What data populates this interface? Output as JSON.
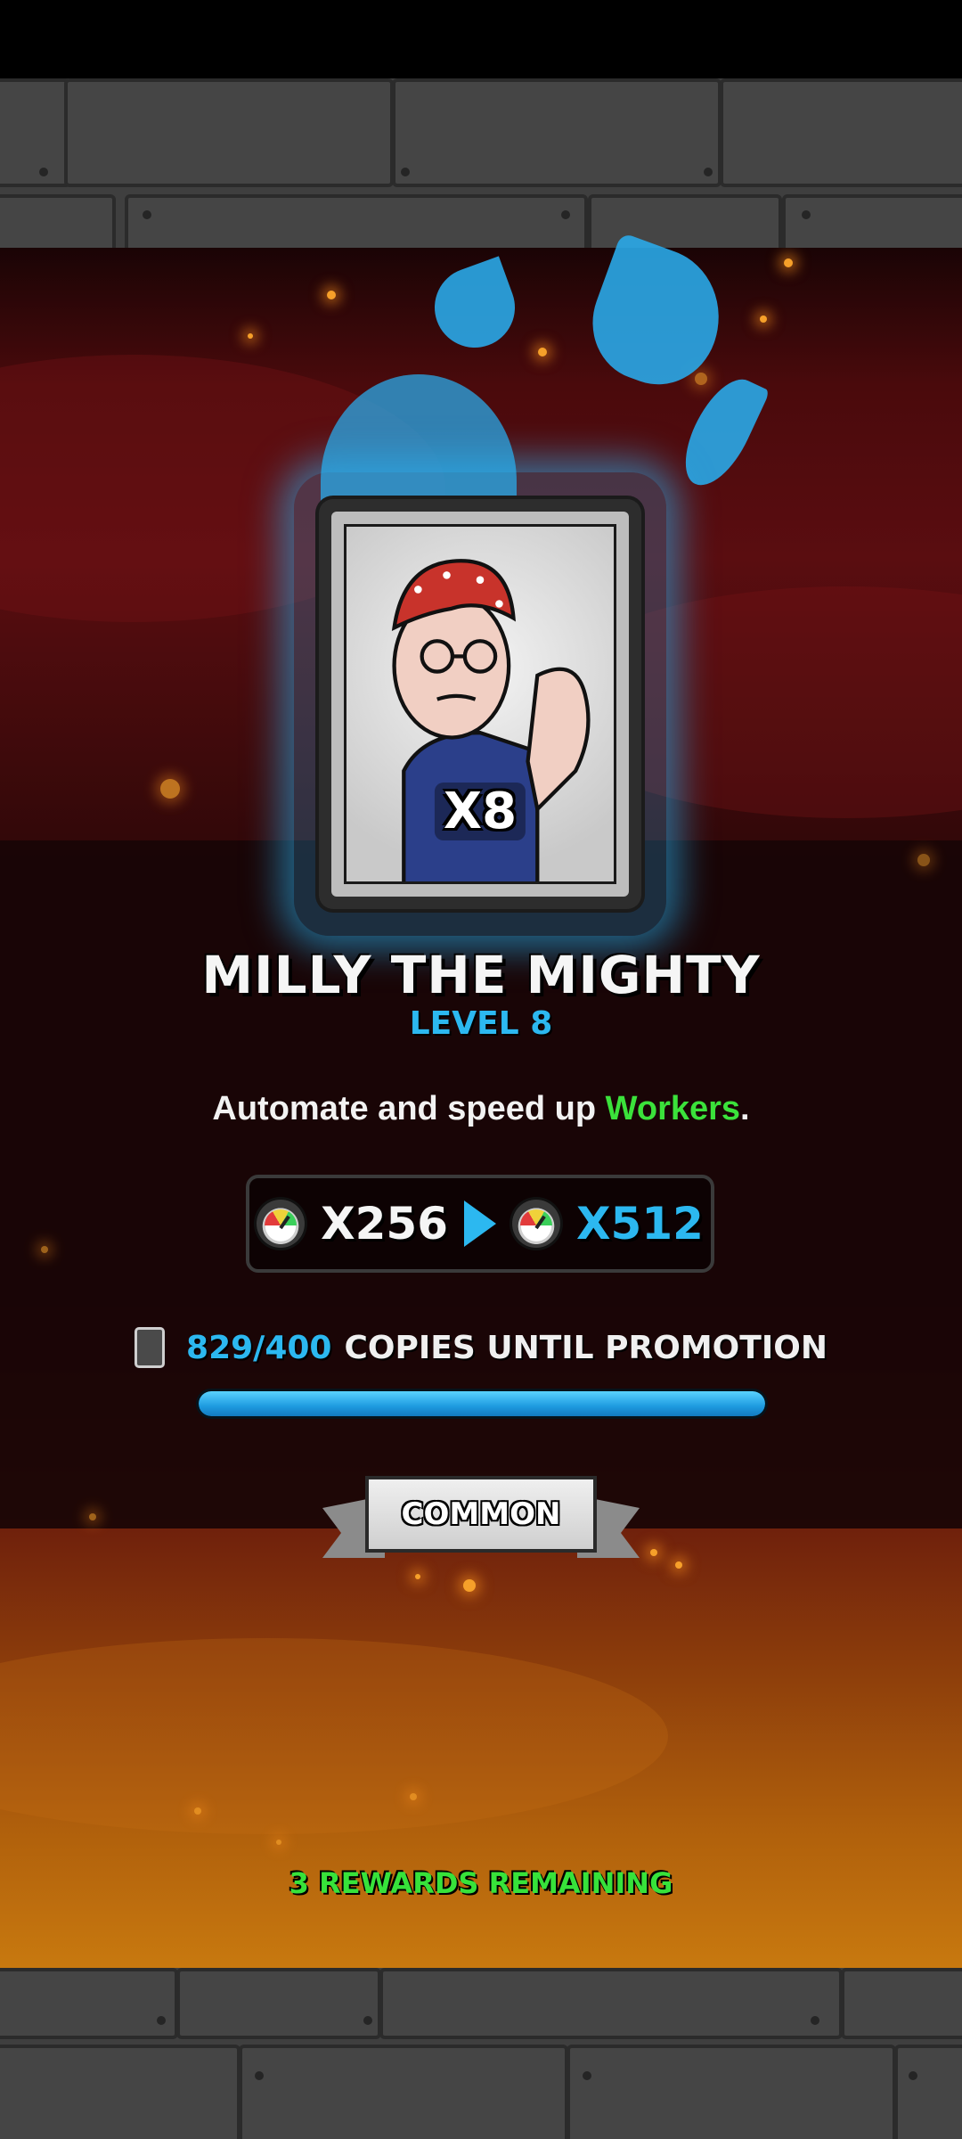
{
  "character": {
    "name": "MILLY THE MIGHTY",
    "level_label": "LEVEL 8",
    "card_count": "X8",
    "rarity": "COMMON"
  },
  "description": {
    "prefix": "Automate and speed up ",
    "highlight": "Workers",
    "suffix": "."
  },
  "multiplier": {
    "current": "X256",
    "next": "X512",
    "icon": "speed-gauge-icon"
  },
  "promotion": {
    "count_text": "829/400",
    "label": "COPIES UNTIL PROMOTION",
    "progress_percent": 100
  },
  "footer": {
    "rewards_remaining": "3 REWARDS REMAINING"
  },
  "colors": {
    "accent_blue": "#2cb8f0",
    "highlight_green": "#3be23b",
    "rewards_green": "#37e23a"
  }
}
